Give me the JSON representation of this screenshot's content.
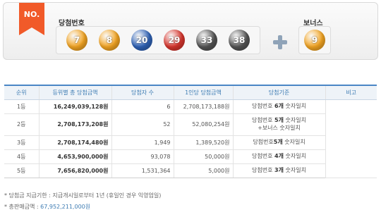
{
  "panel": {
    "badge": "NO.",
    "main_label": "당첨번호",
    "bonus_label": "보너스",
    "numbers": [
      {
        "value": "7",
        "color": "#f5a623"
      },
      {
        "value": "8",
        "color": "#f5a623"
      },
      {
        "value": "20",
        "color": "#2f63b8"
      },
      {
        "value": "29",
        "color": "#d9362e"
      },
      {
        "value": "33",
        "color": "#555555"
      },
      {
        "value": "38",
        "color": "#555555"
      }
    ],
    "bonus": {
      "value": "9",
      "color": "#f5a623"
    },
    "plus_icon": "plus-icon"
  },
  "table": {
    "headers": [
      "순위",
      "등위별 총 당첨금액",
      "당첨자 수",
      "1인당 당첨금액",
      "당첨기준",
      "비고"
    ],
    "rows": [
      {
        "rank": "1등",
        "total": "16,249,039,128원",
        "winners": "6",
        "per": "2,708,173,188원",
        "criteria_pre": "당첨번호 ",
        "criteria_bold": "6개",
        "criteria_post": " 숫자일치",
        "criteria_line2": ""
      },
      {
        "rank": "2등",
        "total": "2,708,173,208원",
        "winners": "52",
        "per": "52,080,254원",
        "criteria_pre": "당첨번호 ",
        "criteria_bold": "5개",
        "criteria_post": " 숫자일치",
        "criteria_line2": "+보너스 숫자일치"
      },
      {
        "rank": "3등",
        "total": "2,708,174,480원",
        "winners": "1,949",
        "per": "1,389,520원",
        "criteria_pre": "당첨번호",
        "criteria_bold": "5개",
        "criteria_post": " 숫자일치",
        "criteria_line2": ""
      },
      {
        "rank": "4등",
        "total": "4,653,900,000원",
        "winners": "93,078",
        "per": "50,000원",
        "criteria_pre": "당첨번호 ",
        "criteria_bold": "4개",
        "criteria_post": " 숫자일치",
        "criteria_line2": ""
      },
      {
        "rank": "5등",
        "total": "7,656,820,000원",
        "winners": "1,531,364",
        "per": "5,000원",
        "criteria_pre": "당첨번호 ",
        "criteria_bold": "3개",
        "criteria_post": " 숫자일치",
        "criteria_line2": ""
      }
    ],
    "note_value": ""
  },
  "notes": {
    "deadline": "* 당첨금 지급기한 : 지급개시일로부터 1년 (휴일인 경우 익영업일)",
    "sales_label": "* 총판매금액 : ",
    "sales_amount": "67,952,211,000원"
  }
}
